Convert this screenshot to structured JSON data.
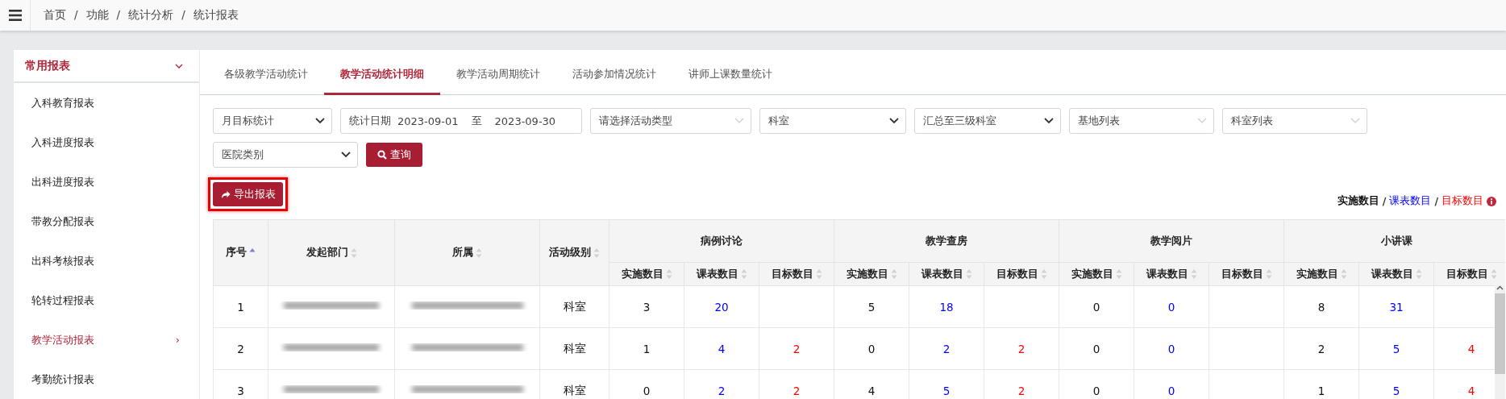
{
  "breadcrumb": [
    "首页",
    "功能",
    "统计分析",
    "统计报表"
  ],
  "breadcrumb_separators": [
    "/",
    "/",
    "/"
  ],
  "sidebar": {
    "title": "常用报表",
    "expanded": true,
    "items": [
      {
        "label": "入科教育报表",
        "selected": false
      },
      {
        "label": "入科进度报表",
        "selected": false
      },
      {
        "label": "出科进度报表",
        "selected": false
      },
      {
        "label": "带教分配报表",
        "selected": false
      },
      {
        "label": "出科考核报表",
        "selected": false
      },
      {
        "label": "轮转过程报表",
        "selected": false
      },
      {
        "label": "教学活动报表",
        "selected": true,
        "arrow": "›"
      },
      {
        "label": "考勤统计报表",
        "selected": false
      }
    ]
  },
  "tabs": [
    {
      "label": "各级教学活动统计",
      "selected": false
    },
    {
      "label": "教学活动统计明细",
      "selected": true
    },
    {
      "label": "教学活动周期统计",
      "selected": false
    },
    {
      "label": "活动参加情况统计",
      "selected": false
    },
    {
      "label": "讲师上课数量统计",
      "selected": false
    }
  ],
  "filters": [
    {
      "kind": "select",
      "value": "月目标统计"
    },
    {
      "kind": "daterange",
      "label": "统计日期",
      "from": "2023-09-01",
      "sep": "至",
      "to": "2023-09-30"
    },
    {
      "kind": "dropdown",
      "placeholder": "请选择活动类型"
    },
    {
      "kind": "select",
      "value": "科室"
    },
    {
      "kind": "select",
      "value": "汇总至三级科室"
    },
    {
      "kind": "dropdown",
      "placeholder": "基地列表"
    },
    {
      "kind": "dropdown",
      "placeholder": "科室列表"
    },
    {
      "kind": "select",
      "value": "医院类别"
    },
    {
      "kind": "button",
      "label": "查询"
    }
  ],
  "export_button": {
    "label": "导出报表",
    "highlighted": true
  },
  "legend": [
    {
      "kind": "actual",
      "label": "实施数目"
    },
    {
      "kind": "scheduled",
      "label": "课表数目"
    },
    {
      "kind": "target",
      "label": "目标数目"
    }
  ],
  "legend_separators": [
    "/",
    "/"
  ],
  "table": {
    "columns": [
      {
        "label": "序号",
        "sorted": true
      },
      {
        "label": "发起部门",
        "sorted": false
      },
      {
        "label": "所属",
        "sorted": false
      },
      {
        "label": "活动级别",
        "sorted": false
      }
    ],
    "groups": [
      {
        "label": "病例讨论",
        "sub_columns": [
          {
            "label": "实施数目",
            "sorted": false
          },
          {
            "label": "课表数目",
            "sorted": false
          },
          {
            "label": "目标数目",
            "sorted": false
          }
        ]
      },
      {
        "label": "教学查房",
        "sub_columns": [
          {
            "label": "实施数目",
            "sorted": false
          },
          {
            "label": "课表数目",
            "sorted": false
          },
          {
            "label": "目标数目",
            "sorted": false
          }
        ]
      },
      {
        "label": "教学阅片",
        "sub_columns": [
          {
            "label": "实施数目",
            "sorted": false
          },
          {
            "label": "课表数目",
            "sorted": false
          },
          {
            "label": "目标数目",
            "sorted": false
          }
        ]
      },
      {
        "label": "小讲课",
        "sub_columns": [
          {
            "label": "实施数目",
            "sorted": false
          },
          {
            "label": "课表数目",
            "sorted": false
          },
          {
            "label": "目标数目",
            "sorted": false
          }
        ]
      }
    ],
    "rows": [
      {
        "index": "1",
        "department": {
          "kind": "redacted"
        },
        "parent": {
          "kind": "redacted"
        },
        "level": "科室",
        "values": [
          [
            {
              "kind": "actual",
              "text": "3"
            },
            {
              "kind": "scheduled",
              "text": "20"
            }
          ],
          [
            {
              "kind": "actual",
              "text": "5"
            },
            {
              "kind": "scheduled",
              "text": "18"
            }
          ],
          [
            {
              "kind": "actual",
              "text": "0"
            },
            {
              "kind": "scheduled",
              "text": "0"
            }
          ],
          [
            {
              "kind": "actual",
              "text": "8"
            },
            {
              "kind": "scheduled",
              "text": "31"
            }
          ]
        ]
      },
      {
        "index": "2",
        "department": {
          "kind": "redacted"
        },
        "parent": {
          "kind": "redacted"
        },
        "level": "科室",
        "values": [
          [
            {
              "kind": "actual",
              "text": "1"
            },
            {
              "kind": "scheduled",
              "text": "4"
            },
            {
              "kind": "target",
              "text": "2"
            }
          ],
          [
            {
              "kind": "actual",
              "text": "0"
            },
            {
              "kind": "scheduled",
              "text": "2"
            },
            {
              "kind": "target",
              "text": "2"
            }
          ],
          [
            {
              "kind": "actual",
              "text": "0"
            },
            {
              "kind": "scheduled",
              "text": "0"
            }
          ],
          [
            {
              "kind": "actual",
              "text": "2"
            },
            {
              "kind": "scheduled",
              "text": "5"
            },
            {
              "kind": "target",
              "text": "4"
            }
          ]
        ]
      },
      {
        "index": "3",
        "department": {
          "kind": "redacted"
        },
        "parent": {
          "kind": "redacted"
        },
        "level": "科室",
        "values": [
          [
            {
              "kind": "actual",
              "text": "0"
            },
            {
              "kind": "scheduled",
              "text": "2"
            },
            {
              "kind": "target",
              "text": "2"
            }
          ],
          [
            {
              "kind": "actual",
              "text": "4"
            },
            {
              "kind": "scheduled",
              "text": "5"
            },
            {
              "kind": "target",
              "text": "2"
            }
          ],
          [
            {
              "kind": "actual",
              "text": "0"
            },
            {
              "kind": "scheduled",
              "text": "0"
            }
          ],
          [
            {
              "kind": "actual",
              "text": "1"
            },
            {
              "kind": "scheduled",
              "text": "5"
            },
            {
              "kind": "target",
              "text": "4"
            }
          ]
        ]
      }
    ]
  }
}
